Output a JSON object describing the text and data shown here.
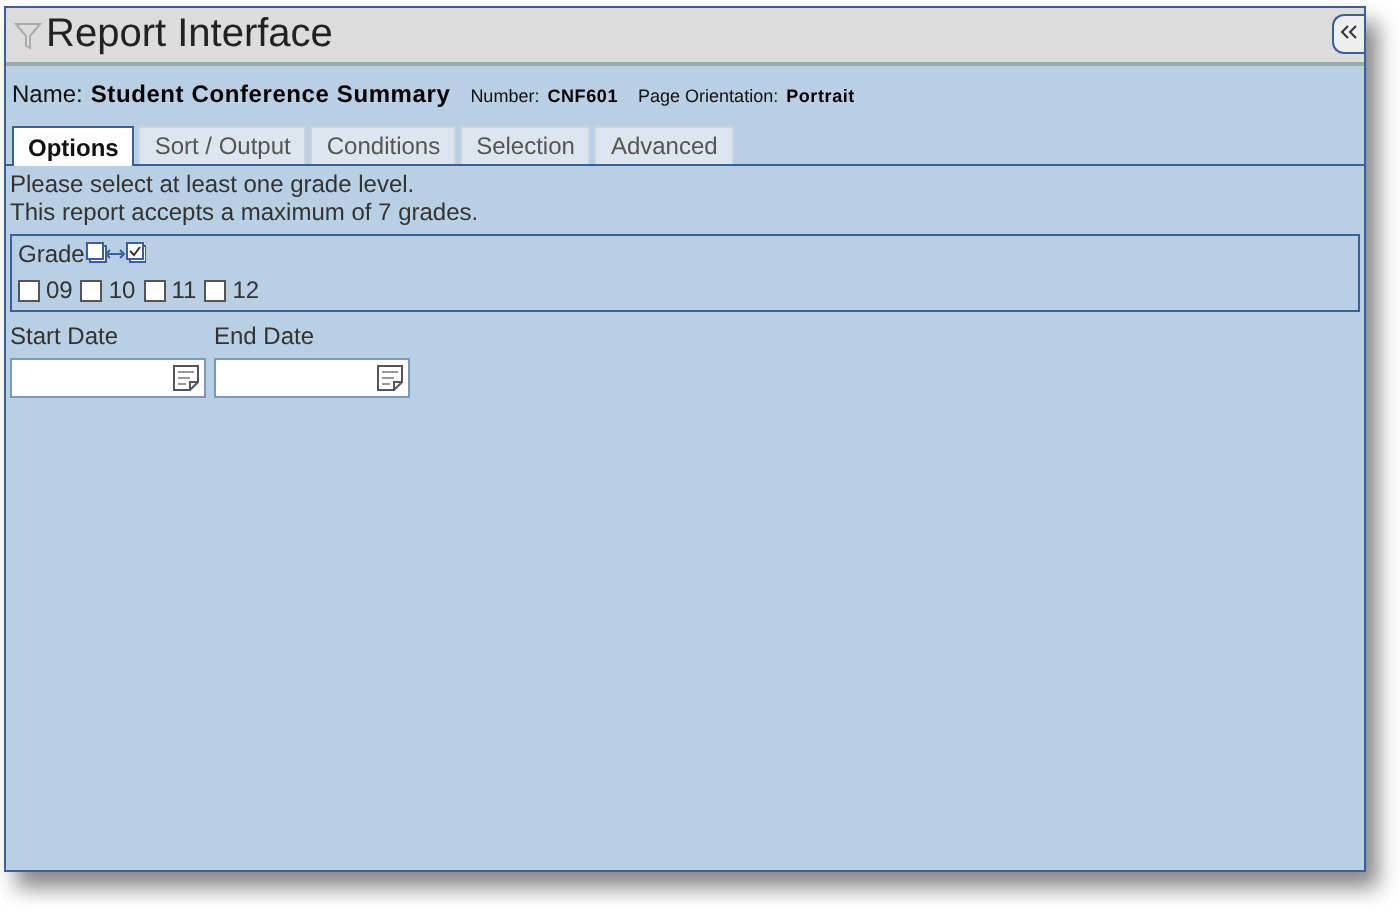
{
  "window": {
    "title": "Report Interface"
  },
  "report": {
    "name_label": "Name:",
    "name": "Student Conference Summary",
    "number_label": "Number:",
    "number": "CNF601",
    "orientation_label": "Page Orientation:",
    "orientation": "Portrait"
  },
  "tabs": [
    {
      "label": "Options",
      "selected": true
    },
    {
      "label": "Sort / Output",
      "selected": false
    },
    {
      "label": "Conditions",
      "selected": false
    },
    {
      "label": "Selection",
      "selected": false
    },
    {
      "label": "Advanced",
      "selected": false
    }
  ],
  "messages": [
    "Please select at least one grade level.",
    "This report accepts a maximum of 7 grades."
  ],
  "grade": {
    "label": "Grade",
    "options": [
      {
        "label": "09",
        "checked": false
      },
      {
        "label": "10",
        "checked": false
      },
      {
        "label": "11",
        "checked": false
      },
      {
        "label": "12",
        "checked": false
      }
    ]
  },
  "dates": [
    {
      "label": "Start Date"
    },
    {
      "label": "End Date"
    }
  ]
}
